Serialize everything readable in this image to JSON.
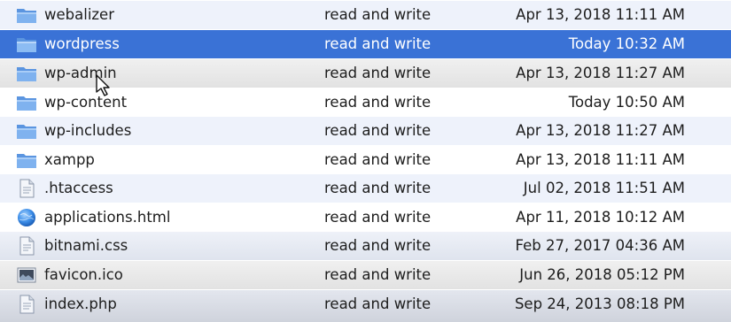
{
  "files": [
    {
      "name": "webalizer",
      "permissions": "read and write",
      "modified": "Apr 13, 2018 11:11 AM",
      "icon": "folder-icon"
    },
    {
      "name": "wordpress",
      "permissions": "read and write",
      "modified": "Today 10:32 AM",
      "icon": "folder-icon",
      "selected": true
    },
    {
      "name": "wp-admin",
      "permissions": "read and write",
      "modified": "Apr 13, 2018 11:27 AM",
      "icon": "folder-icon"
    },
    {
      "name": "wp-content",
      "permissions": "read and write",
      "modified": "Today 10:50 AM",
      "icon": "folder-icon"
    },
    {
      "name": "wp-includes",
      "permissions": "read and write",
      "modified": "Apr 13, 2018 11:27 AM",
      "icon": "folder-icon"
    },
    {
      "name": "xampp",
      "permissions": "read and write",
      "modified": "Apr 13, 2018 11:11 AM",
      "icon": "folder-icon"
    },
    {
      "name": ".htaccess",
      "permissions": "read and write",
      "modified": "Jul 02, 2018 11:51 AM",
      "icon": "text-file-icon"
    },
    {
      "name": "applications.html",
      "permissions": "read and write",
      "modified": "Apr 11, 2018 10:12 AM",
      "icon": "html-globe-icon"
    },
    {
      "name": "bitnami.css",
      "permissions": "read and write",
      "modified": "Feb 27, 2017 04:36 AM",
      "icon": "css-file-icon"
    },
    {
      "name": "favicon.ico",
      "permissions": "read and write",
      "modified": "Jun 26, 2018 05:12 PM",
      "icon": "image-file-icon"
    },
    {
      "name": "index.php",
      "permissions": "read and write",
      "modified": "Sep 24, 2013 08:18 PM",
      "icon": "php-file-icon"
    }
  ],
  "colors": {
    "selection": "#3a72d6",
    "folder": "#6fa4e6",
    "text": "#1d1d1d"
  }
}
